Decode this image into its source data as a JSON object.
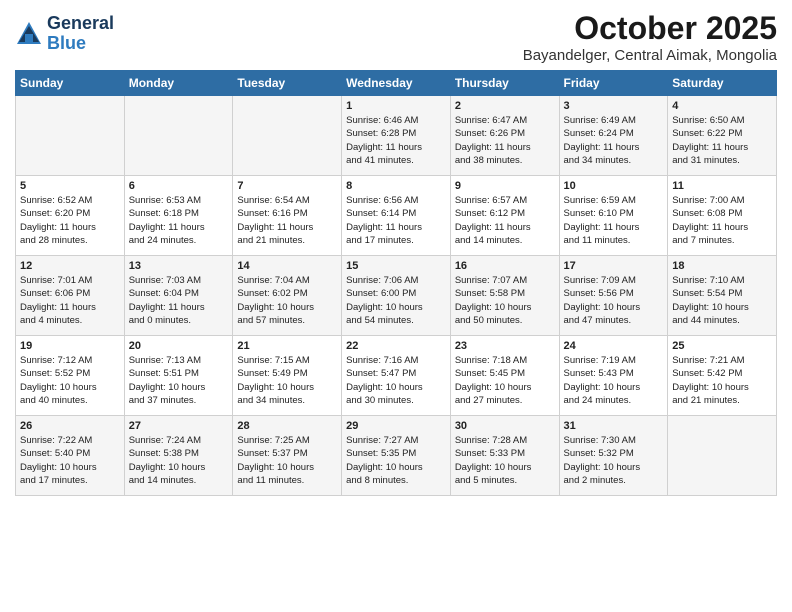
{
  "header": {
    "logo_general": "General",
    "logo_blue": "Blue",
    "month_title": "October 2025",
    "location": "Bayandelger, Central Aimak, Mongolia"
  },
  "days_of_week": [
    "Sunday",
    "Monday",
    "Tuesday",
    "Wednesday",
    "Thursday",
    "Friday",
    "Saturday"
  ],
  "weeks": [
    [
      {
        "day": "",
        "info": ""
      },
      {
        "day": "",
        "info": ""
      },
      {
        "day": "",
        "info": ""
      },
      {
        "day": "1",
        "info": "Sunrise: 6:46 AM\nSunset: 6:28 PM\nDaylight: 11 hours\nand 41 minutes."
      },
      {
        "day": "2",
        "info": "Sunrise: 6:47 AM\nSunset: 6:26 PM\nDaylight: 11 hours\nand 38 minutes."
      },
      {
        "day": "3",
        "info": "Sunrise: 6:49 AM\nSunset: 6:24 PM\nDaylight: 11 hours\nand 34 minutes."
      },
      {
        "day": "4",
        "info": "Sunrise: 6:50 AM\nSunset: 6:22 PM\nDaylight: 11 hours\nand 31 minutes."
      }
    ],
    [
      {
        "day": "5",
        "info": "Sunrise: 6:52 AM\nSunset: 6:20 PM\nDaylight: 11 hours\nand 28 minutes."
      },
      {
        "day": "6",
        "info": "Sunrise: 6:53 AM\nSunset: 6:18 PM\nDaylight: 11 hours\nand 24 minutes."
      },
      {
        "day": "7",
        "info": "Sunrise: 6:54 AM\nSunset: 6:16 PM\nDaylight: 11 hours\nand 21 minutes."
      },
      {
        "day": "8",
        "info": "Sunrise: 6:56 AM\nSunset: 6:14 PM\nDaylight: 11 hours\nand 17 minutes."
      },
      {
        "day": "9",
        "info": "Sunrise: 6:57 AM\nSunset: 6:12 PM\nDaylight: 11 hours\nand 14 minutes."
      },
      {
        "day": "10",
        "info": "Sunrise: 6:59 AM\nSunset: 6:10 PM\nDaylight: 11 hours\nand 11 minutes."
      },
      {
        "day": "11",
        "info": "Sunrise: 7:00 AM\nSunset: 6:08 PM\nDaylight: 11 hours\nand 7 minutes."
      }
    ],
    [
      {
        "day": "12",
        "info": "Sunrise: 7:01 AM\nSunset: 6:06 PM\nDaylight: 11 hours\nand 4 minutes."
      },
      {
        "day": "13",
        "info": "Sunrise: 7:03 AM\nSunset: 6:04 PM\nDaylight: 11 hours\nand 0 minutes."
      },
      {
        "day": "14",
        "info": "Sunrise: 7:04 AM\nSunset: 6:02 PM\nDaylight: 10 hours\nand 57 minutes."
      },
      {
        "day": "15",
        "info": "Sunrise: 7:06 AM\nSunset: 6:00 PM\nDaylight: 10 hours\nand 54 minutes."
      },
      {
        "day": "16",
        "info": "Sunrise: 7:07 AM\nSunset: 5:58 PM\nDaylight: 10 hours\nand 50 minutes."
      },
      {
        "day": "17",
        "info": "Sunrise: 7:09 AM\nSunset: 5:56 PM\nDaylight: 10 hours\nand 47 minutes."
      },
      {
        "day": "18",
        "info": "Sunrise: 7:10 AM\nSunset: 5:54 PM\nDaylight: 10 hours\nand 44 minutes."
      }
    ],
    [
      {
        "day": "19",
        "info": "Sunrise: 7:12 AM\nSunset: 5:52 PM\nDaylight: 10 hours\nand 40 minutes."
      },
      {
        "day": "20",
        "info": "Sunrise: 7:13 AM\nSunset: 5:51 PM\nDaylight: 10 hours\nand 37 minutes."
      },
      {
        "day": "21",
        "info": "Sunrise: 7:15 AM\nSunset: 5:49 PM\nDaylight: 10 hours\nand 34 minutes."
      },
      {
        "day": "22",
        "info": "Sunrise: 7:16 AM\nSunset: 5:47 PM\nDaylight: 10 hours\nand 30 minutes."
      },
      {
        "day": "23",
        "info": "Sunrise: 7:18 AM\nSunset: 5:45 PM\nDaylight: 10 hours\nand 27 minutes."
      },
      {
        "day": "24",
        "info": "Sunrise: 7:19 AM\nSunset: 5:43 PM\nDaylight: 10 hours\nand 24 minutes."
      },
      {
        "day": "25",
        "info": "Sunrise: 7:21 AM\nSunset: 5:42 PM\nDaylight: 10 hours\nand 21 minutes."
      }
    ],
    [
      {
        "day": "26",
        "info": "Sunrise: 7:22 AM\nSunset: 5:40 PM\nDaylight: 10 hours\nand 17 minutes."
      },
      {
        "day": "27",
        "info": "Sunrise: 7:24 AM\nSunset: 5:38 PM\nDaylight: 10 hours\nand 14 minutes."
      },
      {
        "day": "28",
        "info": "Sunrise: 7:25 AM\nSunset: 5:37 PM\nDaylight: 10 hours\nand 11 minutes."
      },
      {
        "day": "29",
        "info": "Sunrise: 7:27 AM\nSunset: 5:35 PM\nDaylight: 10 hours\nand 8 minutes."
      },
      {
        "day": "30",
        "info": "Sunrise: 7:28 AM\nSunset: 5:33 PM\nDaylight: 10 hours\nand 5 minutes."
      },
      {
        "day": "31",
        "info": "Sunrise: 7:30 AM\nSunset: 5:32 PM\nDaylight: 10 hours\nand 2 minutes."
      },
      {
        "day": "",
        "info": ""
      }
    ]
  ]
}
